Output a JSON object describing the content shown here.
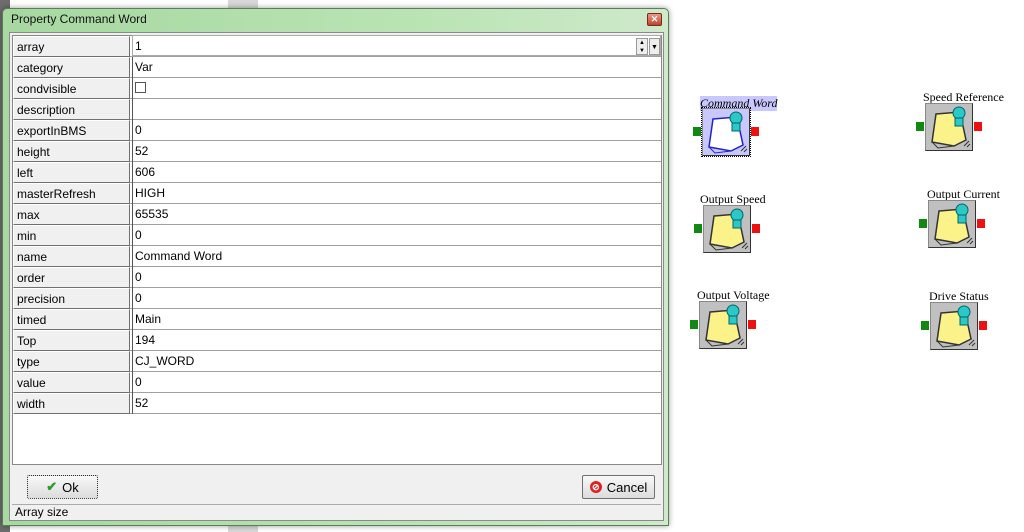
{
  "dialog": {
    "title": "Property Command Word",
    "properties": [
      {
        "name": "array",
        "value": "1"
      },
      {
        "name": "category",
        "value": "Var"
      },
      {
        "name": "condvisible",
        "value": "",
        "checkbox": true
      },
      {
        "name": "description",
        "value": ""
      },
      {
        "name": "exportInBMS",
        "value": "0"
      },
      {
        "name": "height",
        "value": "52"
      },
      {
        "name": "left",
        "value": "606"
      },
      {
        "name": "masterRefresh",
        "value": "HIGH"
      },
      {
        "name": "max",
        "value": "65535"
      },
      {
        "name": "min",
        "value": "0"
      },
      {
        "name": "name",
        "value": "Command Word"
      },
      {
        "name": "order",
        "value": "0"
      },
      {
        "name": "precision",
        "value": "0"
      },
      {
        "name": "timed",
        "value": "Main"
      },
      {
        "name": "Top",
        "value": "194"
      },
      {
        "name": "type",
        "value": "CJ_WORD"
      },
      {
        "name": "value",
        "value": "0"
      },
      {
        "name": "width",
        "value": "52"
      }
    ],
    "ok_label": "Ok",
    "cancel_label": "Cancel",
    "status": "Array size"
  },
  "canvas": {
    "nodes": [
      {
        "label": "Command Word",
        "selected": true
      },
      {
        "label": "Speed Reference"
      },
      {
        "label": "Output Speed"
      },
      {
        "label": "Output Current"
      },
      {
        "label": "Output Voltage"
      },
      {
        "label": "Drive Status"
      }
    ]
  },
  "colors": {
    "input_port": "#118811",
    "output_port": "#ee1111",
    "selection": "#c8c8ff"
  }
}
